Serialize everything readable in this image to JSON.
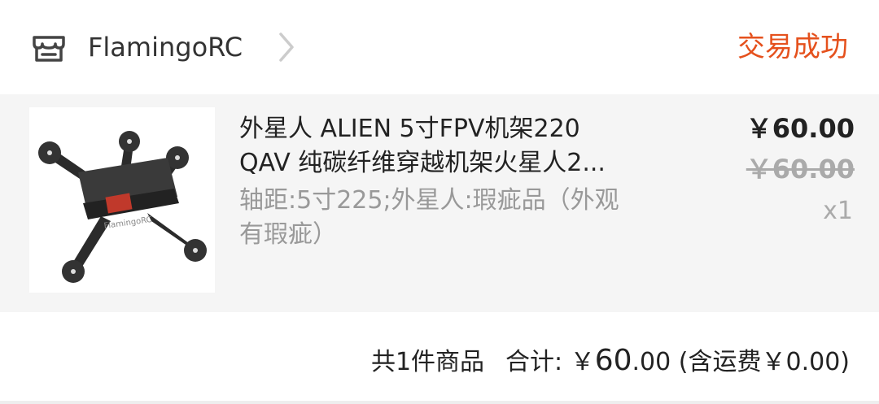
{
  "header": {
    "shop_icon": "store-icon",
    "shop_name": "FlamingoRC",
    "chevron_icon": "chevron-right-icon",
    "status": "交易成功",
    "status_color": "#e5511d"
  },
  "item": {
    "image_alt": "product-thumbnail",
    "title_line1": "外星人 ALIEN 5寸FPV机架220",
    "title_line2": "QAV 纯碳纤维穿越机架火星人2...",
    "specs_line1": "轴距:5寸225;外星人:瑕疵品（外观",
    "specs_line2": "有瑕疵）",
    "price": "￥60.00",
    "original_price": "￥60.00",
    "quantity": "x1"
  },
  "summary": {
    "count_text": "共1件商品",
    "total_label": "合计:",
    "total_currency": "￥",
    "total_integer": "60",
    "total_decimal": ".00",
    "shipping_text": "(含运费￥0.00)"
  }
}
